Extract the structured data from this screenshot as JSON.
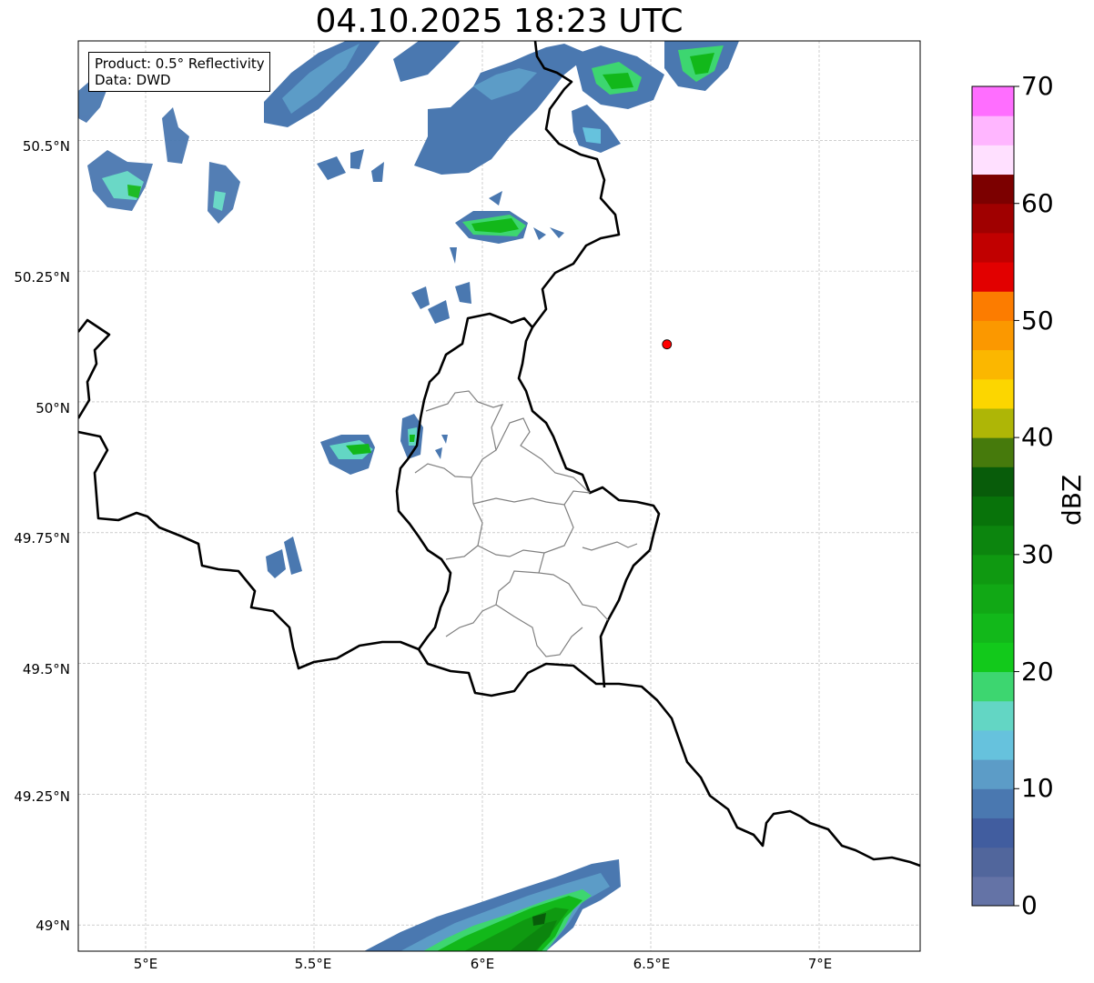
{
  "title": "04.10.2025 18:23 UTC",
  "info": {
    "product": "Product: 0.5° Reflectivity",
    "data": "Data: DWD"
  },
  "map": {
    "lon_range": [
      4.8,
      7.3
    ],
    "lat_range": [
      48.95,
      50.69
    ],
    "lat_ticks": [
      {
        "value": 50.5,
        "label": "50.5°N"
      },
      {
        "value": 50.25,
        "label": "50.25°N"
      },
      {
        "value": 50.0,
        "label": "50°N"
      },
      {
        "value": 49.75,
        "label": "49.75°N"
      },
      {
        "value": 49.5,
        "label": "49.5°N"
      },
      {
        "value": 49.25,
        "label": "49.25°N"
      },
      {
        "value": 49.0,
        "label": "49°N"
      }
    ],
    "lon_ticks": [
      {
        "value": 5.0,
        "label": "5°E"
      },
      {
        "value": 5.5,
        "label": "5.5°E"
      },
      {
        "value": 6.0,
        "label": "6°E"
      },
      {
        "value": 6.5,
        "label": "6.5°E"
      },
      {
        "value": 7.0,
        "label": "7°E"
      }
    ],
    "grid": true,
    "radar_site": {
      "lon": 6.548,
      "lat": 50.11,
      "color": "#ff0000"
    }
  },
  "colorbar": {
    "label": "dBZ",
    "min": 0,
    "max": 70,
    "step": 2.5,
    "ticks": [
      "0",
      "10",
      "20",
      "30",
      "40",
      "50",
      "60",
      "70"
    ],
    "colors": [
      "#6473a6",
      "#51669c",
      "#415d9f",
      "#4a78b0",
      "#5c9cc7",
      "#66c2dd",
      "#63d6c4",
      "#3dd670",
      "#12c91b",
      "#12b81a",
      "#11a815",
      "#0f9911",
      "#0c850e",
      "#08730a",
      "#085c0a",
      "#467a0c",
      "#aeb606",
      "#fcd600",
      "#fbb700",
      "#fb9800",
      "#fc7c00",
      "#e20000",
      "#c10000",
      "#a00000",
      "#7c0000",
      "#ffe0ff",
      "#ffb6ff",
      "#ff6eff",
      "#ec3cec"
    ]
  }
}
